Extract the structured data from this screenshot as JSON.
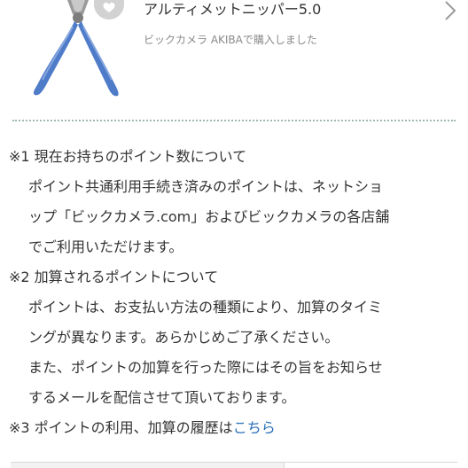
{
  "product": {
    "name": "アルティメットニッパー5.0",
    "store": "ビックカメラ AKIBAで購入しました",
    "image_icon": "blue-nipper-image",
    "badge_icon": "heart-icon",
    "chevron_icon": "chevron-right-icon"
  },
  "notes": [
    {
      "heading": "※1 現在お持ちのポイント数について",
      "body": [
        "ポイント共通利用手続き済みのポイントは、ネットショ",
        "ップ「ビックカメラ.com」およびビックカメラの各店舗",
        "でご利用いただけます。"
      ]
    },
    {
      "heading": "※2 加算されるポイントについて",
      "body": [
        "ポイントは、お支払い方法の種類により、加算のタイミ",
        "ングが異なります。あらかじめご了承ください。",
        "また、ポイントの加算を行った際にはその旨をお知らせ",
        "するメールを配信させて頂いております。"
      ]
    }
  ],
  "note3": {
    "prefix": "※3 ポイントの利用、加算の履歴は",
    "link": "こちら"
  },
  "colors": {
    "link": "#2a6fb8",
    "tool_handle": "#4f7cc9",
    "divider": "#9fb8b4"
  }
}
